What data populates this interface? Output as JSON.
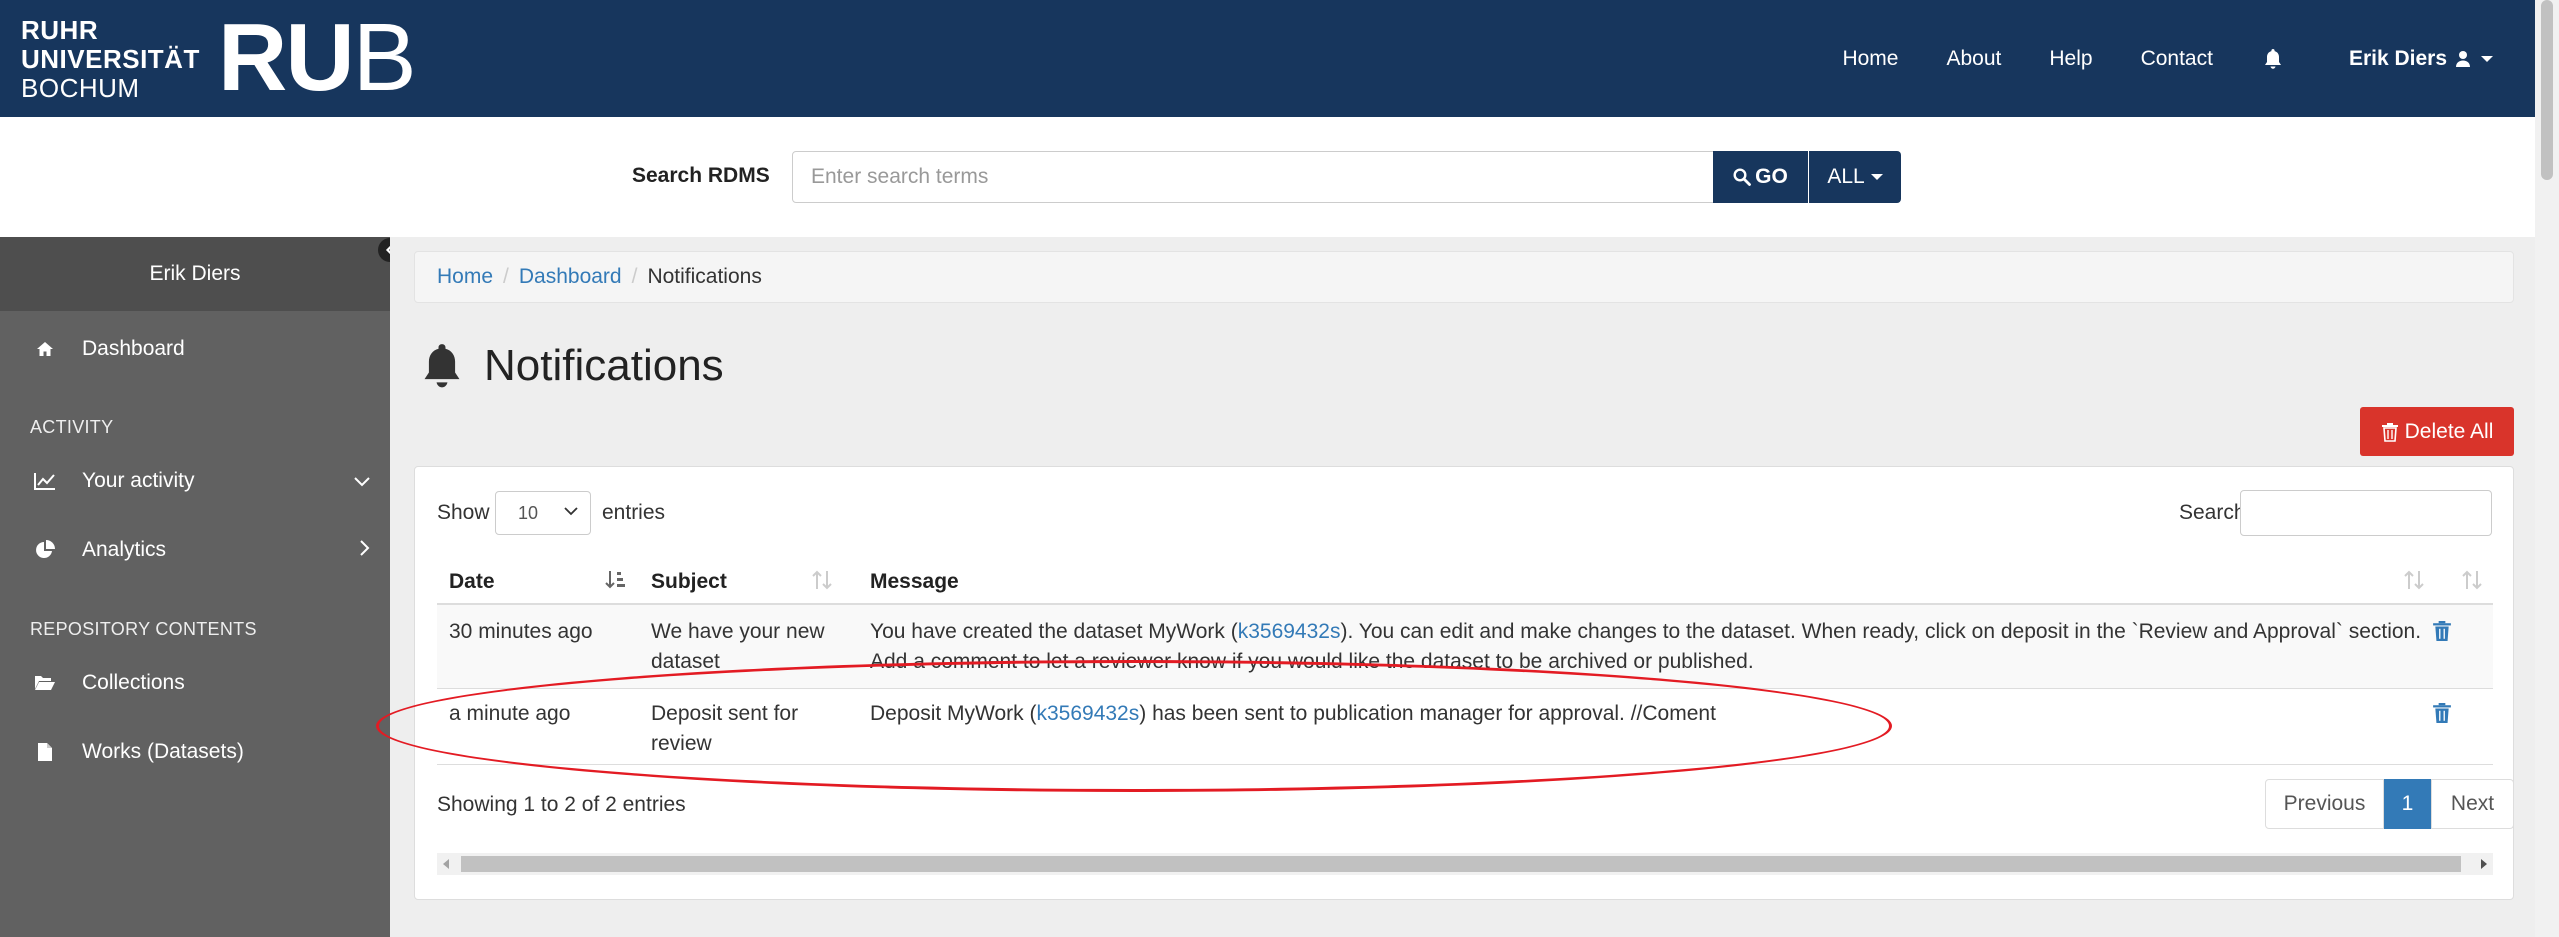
{
  "header": {
    "logo_line1": "RUHR",
    "logo_line2": "UNIVERSITÄT",
    "logo_line3": "BOCHUM",
    "logo_ru": "RU",
    "logo_b": "B",
    "nav": [
      "Home",
      "About",
      "Help",
      "Contact"
    ],
    "user_name": "Erik Diers"
  },
  "search": {
    "label": "Search RDMS",
    "placeholder": "Enter search terms",
    "go_label": "GO",
    "scope_label": "ALL"
  },
  "sidebar": {
    "user_name": "Erik Diers",
    "dashboard": "Dashboard",
    "activity_heading": "ACTIVITY",
    "your_activity": "Your activity",
    "analytics": "Analytics",
    "repo_heading": "REPOSITORY CONTENTS",
    "collections": "Collections",
    "works": "Works (Datasets)"
  },
  "breadcrumb": {
    "home": "Home",
    "dashboard": "Dashboard",
    "current": "Notifications"
  },
  "page": {
    "title": "Notifications",
    "delete_all": "Delete All"
  },
  "table": {
    "show_label": "Show",
    "page_length": "10",
    "entries_label": "entries",
    "search_label": "Search:",
    "columns": {
      "date": "Date",
      "subject": "Subject",
      "message": "Message"
    },
    "rows": [
      {
        "date": "30 minutes ago",
        "subject_l1": "We have your new",
        "subject_l2": "dataset",
        "msg_pre": "You have created the dataset MyWork (",
        "msg_link": "k3569432s",
        "msg_post": "). You can edit and make changes to the dataset. When ready, click on deposit in the `Review and Approval` section.",
        "msg_l2": "Add a comment to let a reviewer know if you would like the dataset to be archived or published."
      },
      {
        "date": "a minute ago",
        "subject_l1": "Deposit sent for",
        "subject_l2": "review",
        "msg_pre": "Deposit MyWork (",
        "msg_link": "k3569432s",
        "msg_post": ") has been sent to publication manager for approval. //Coment"
      }
    ],
    "info": "Showing 1 to 2 of 2 entries",
    "pager": {
      "previous": "Previous",
      "current": "1",
      "next": "Next"
    }
  },
  "colors": {
    "brand": "#17365d",
    "sidebar": "#616161",
    "link": "#337ab7",
    "danger": "#d9342b",
    "annotation": "#e31b23"
  }
}
